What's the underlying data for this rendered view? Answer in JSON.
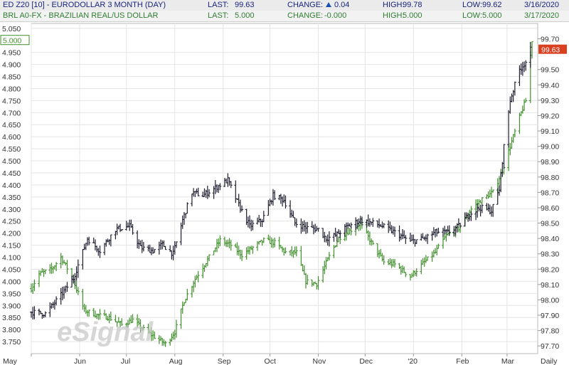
{
  "header": {
    "row1": {
      "symbol": "ED Z20 [10] - EURODOLLAR 3 MONTH (DAY)",
      "last_label": "LAST:",
      "last": "99.63",
      "change_label": "CHANGE:",
      "change": "0.04",
      "high_label": "HIGH:",
      "high": "99.78",
      "low_label": "LOW:",
      "low": "99.62",
      "date": "3/16/2020"
    },
    "row2": {
      "symbol": "BRL A0-FX - BRAZILIAN REAL/US DOLLAR",
      "last_label": "LAST:",
      "last": "5.000",
      "change_label": "CHANGE:",
      "change": "-0.000",
      "high_label": "HIGH:",
      "high": "5.000",
      "low_label": "LOW:",
      "low": "5.000",
      "date": "3/17/2020"
    }
  },
  "watermark": "eSignal",
  "colors": {
    "eurodollar": "#1c1c2e",
    "brl": "#3f8f2a",
    "last_tag": "#d94020",
    "grid": "#e4e4e4",
    "header_blue": "#1a237e",
    "header_green": "#2e7d32"
  },
  "chart_data": {
    "type": "line",
    "style": "ohlc-bars",
    "grid": true,
    "x_labels": [
      "May",
      "Jun",
      "Jul",
      "Aug",
      "Sep",
      "Oct",
      "Nov",
      "Dec",
      "'20",
      "Feb",
      "Mar",
      "Daily"
    ],
    "left_axis": {
      "series": "BRL A0-FX",
      "ylim": [
        3.7,
        5.07
      ],
      "ticks": [
        "3.750",
        "3.800",
        "3.850",
        "3.900",
        "3.950",
        "4.000",
        "4.050",
        "4.100",
        "4.150",
        "4.200",
        "4.250",
        "4.300",
        "4.350",
        "4.400",
        "4.450",
        "4.500",
        "4.550",
        "4.600",
        "4.650",
        "4.700",
        "4.750",
        "4.800",
        "4.850",
        "4.900",
        "4.950",
        "5.050"
      ],
      "last_tag": "5.000"
    },
    "right_axis": {
      "series": "ED Z20",
      "ylim": [
        97.65,
        99.8
      ],
      "ticks": [
        "97.70",
        "97.80",
        "97.90",
        "98.00",
        "98.10",
        "98.20",
        "98.30",
        "98.40",
        "98.50",
        "98.60",
        "98.70",
        "98.80",
        "98.90",
        "99.00",
        "99.10",
        "99.20",
        "99.30",
        "99.40",
        "99.50",
        "99.70"
      ],
      "last_tag": "99.63"
    },
    "series": [
      {
        "name": "ED Z20 [10] - EURODOLLAR 3 MONTH (DAY)",
        "axis": "right",
        "anchors": [
          [
            "2019-05-01",
            97.92
          ],
          [
            "2019-05-10",
            97.91
          ],
          [
            "2019-05-20",
            98.03
          ],
          [
            "2019-05-28",
            98.14
          ],
          [
            "2019-06-06",
            98.4
          ],
          [
            "2019-06-14",
            98.32
          ],
          [
            "2019-06-24",
            98.46
          ],
          [
            "2019-07-03",
            98.48
          ],
          [
            "2019-07-10",
            98.34
          ],
          [
            "2019-07-18",
            98.32
          ],
          [
            "2019-07-24",
            98.36
          ],
          [
            "2019-07-31",
            98.3
          ],
          [
            "2019-08-06",
            98.52
          ],
          [
            "2019-08-12",
            98.7
          ],
          [
            "2019-08-19",
            98.68
          ],
          [
            "2019-08-27",
            98.73
          ],
          [
            "2019-09-04",
            98.78
          ],
          [
            "2019-09-10",
            98.64
          ],
          [
            "2019-09-18",
            98.48
          ],
          [
            "2019-09-26",
            98.52
          ],
          [
            "2019-10-03",
            98.68
          ],
          [
            "2019-10-10",
            98.65
          ],
          [
            "2019-10-17",
            98.5
          ],
          [
            "2019-10-25",
            98.47
          ],
          [
            "2019-11-01",
            98.46
          ],
          [
            "2019-11-06",
            98.4
          ],
          [
            "2019-11-12",
            98.42
          ],
          [
            "2019-11-20",
            98.48
          ],
          [
            "2019-11-28",
            98.52
          ],
          [
            "2019-12-06",
            98.5
          ],
          [
            "2019-12-12",
            98.48
          ],
          [
            "2019-12-20",
            98.44
          ],
          [
            "2019-12-30",
            98.38
          ],
          [
            "2020-01-08",
            98.4
          ],
          [
            "2020-01-15",
            98.44
          ],
          [
            "2020-01-23",
            98.44
          ],
          [
            "2020-01-30",
            98.48
          ],
          [
            "2020-02-06",
            98.56
          ],
          [
            "2020-02-13",
            98.6
          ],
          [
            "2020-02-20",
            98.58
          ],
          [
            "2020-02-25",
            98.72
          ],
          [
            "2020-02-28",
            99.0
          ],
          [
            "2020-03-03",
            99.3
          ],
          [
            "2020-03-09",
            99.5
          ],
          [
            "2020-03-13",
            99.55
          ],
          [
            "2020-03-16",
            99.63
          ]
        ]
      },
      {
        "name": "BRL A0-FX - BRAZILIAN REAL/US DOLLAR",
        "axis": "left",
        "anchors": [
          [
            "2019-05-01",
            3.97
          ],
          [
            "2019-05-06",
            4.03
          ],
          [
            "2019-05-14",
            4.05
          ],
          [
            "2019-05-20",
            4.1
          ],
          [
            "2019-05-27",
            4.02
          ],
          [
            "2019-06-04",
            3.88
          ],
          [
            "2019-06-12",
            3.86
          ],
          [
            "2019-06-20",
            3.85
          ],
          [
            "2019-06-28",
            3.82
          ],
          [
            "2019-07-05",
            3.84
          ],
          [
            "2019-07-12",
            3.8
          ],
          [
            "2019-07-19",
            3.77
          ],
          [
            "2019-07-26",
            3.74
          ],
          [
            "2019-08-01",
            3.79
          ],
          [
            "2019-08-07",
            3.92
          ],
          [
            "2019-08-14",
            4.01
          ],
          [
            "2019-08-22",
            4.09
          ],
          [
            "2019-08-30",
            4.17
          ],
          [
            "2019-09-06",
            4.15
          ],
          [
            "2019-09-13",
            4.11
          ],
          [
            "2019-09-20",
            4.14
          ],
          [
            "2019-09-27",
            4.17
          ],
          [
            "2019-10-04",
            4.16
          ],
          [
            "2019-10-11",
            4.12
          ],
          [
            "2019-10-18",
            4.12
          ],
          [
            "2019-10-24",
            4.0
          ],
          [
            "2019-10-31",
            3.99
          ],
          [
            "2019-11-07",
            4.09
          ],
          [
            "2019-11-14",
            4.18
          ],
          [
            "2019-11-21",
            4.21
          ],
          [
            "2019-11-28",
            4.24
          ],
          [
            "2019-12-06",
            4.15
          ],
          [
            "2019-12-13",
            4.08
          ],
          [
            "2019-12-20",
            4.07
          ],
          [
            "2019-12-30",
            4.02
          ],
          [
            "2020-01-08",
            4.08
          ],
          [
            "2020-01-15",
            4.12
          ],
          [
            "2020-01-22",
            4.19
          ],
          [
            "2020-01-30",
            4.22
          ],
          [
            "2020-02-07",
            4.3
          ],
          [
            "2020-02-14",
            4.34
          ],
          [
            "2020-02-21",
            4.37
          ],
          [
            "2020-02-27",
            4.46
          ],
          [
            "2020-03-04",
            4.58
          ],
          [
            "2020-03-10",
            4.7
          ],
          [
            "2020-03-13",
            4.75
          ],
          [
            "2020-03-17",
            5.0
          ]
        ]
      }
    ]
  }
}
